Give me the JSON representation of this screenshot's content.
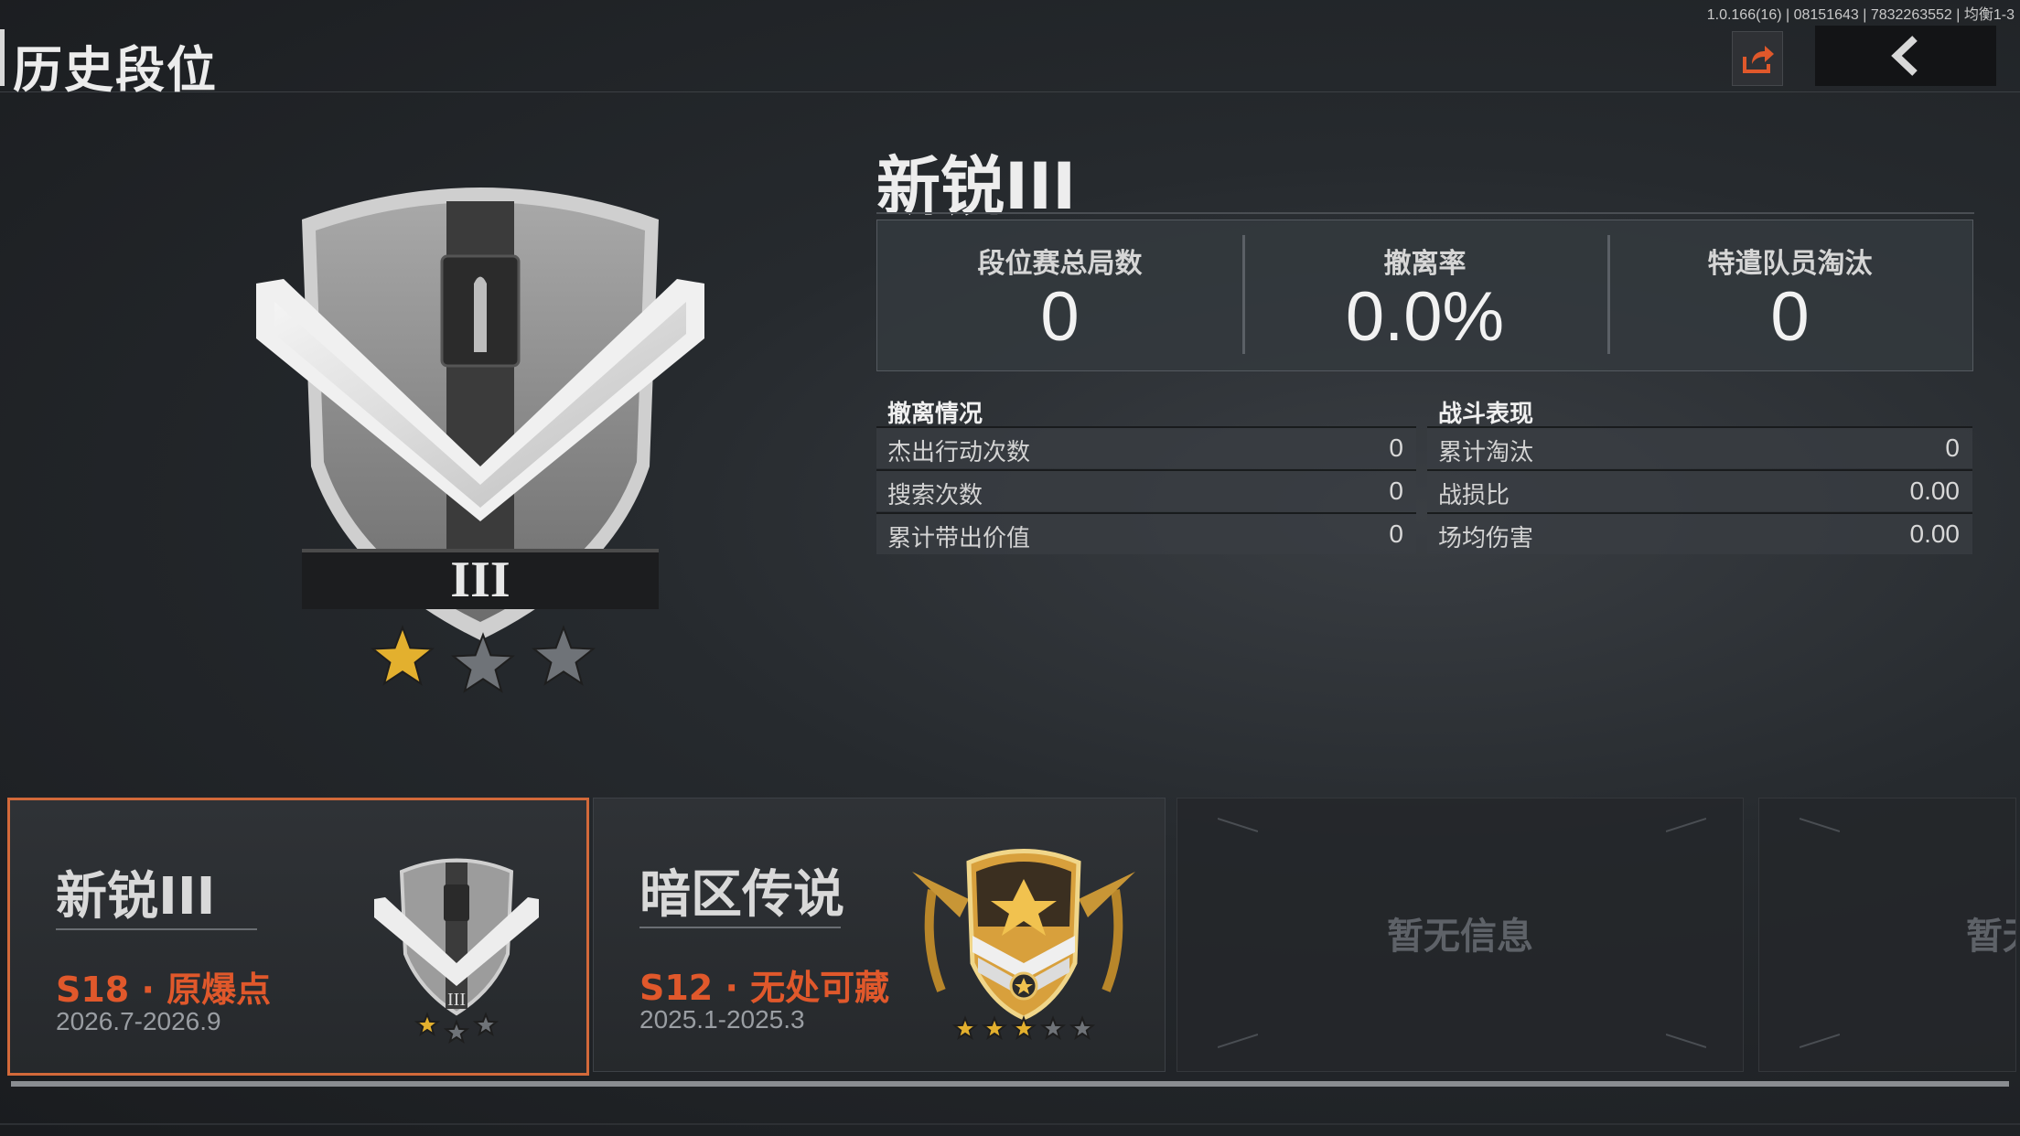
{
  "version_info": "1.0.166(16) | 08151643 | 7832263552 | 均衡1-3",
  "header": {
    "title": "历史段位"
  },
  "current_rank": {
    "name": "新锐III",
    "tier_numeral": "III",
    "stars_earned": 1,
    "stars_total": 3
  },
  "stats": [
    {
      "label": "段位赛总局数",
      "value": "0"
    },
    {
      "label": "撤离率",
      "value": "0.0%"
    },
    {
      "label": "特遣队员淘汰",
      "value": "0"
    }
  ],
  "evacuation": {
    "title": "撤离情况",
    "rows": [
      {
        "label": "杰出行动次数",
        "value": "0"
      },
      {
        "label": "搜索次数",
        "value": "0"
      },
      {
        "label": "累计带出价值",
        "value": "0"
      }
    ]
  },
  "combat": {
    "title": "战斗表现",
    "rows": [
      {
        "label": "累计淘汰",
        "value": "0"
      },
      {
        "label": "战损比",
        "value": "0.00"
      },
      {
        "label": "场均伤害",
        "value": "0.00"
      }
    ]
  },
  "seasons": [
    {
      "rank": "新锐III",
      "season": "S18 · 原爆点",
      "dates": "2026.7-2026.9",
      "emblem_numeral": "III",
      "stars_earned": 1,
      "stars_total": 3
    },
    {
      "rank": "暗区传说",
      "season": "S12 · 无处可藏",
      "dates": "2025.1-2025.3",
      "stars_earned": 3,
      "stars_total": 5
    },
    {
      "empty_text": "暂无信息"
    },
    {
      "empty_text": "暂无信息"
    }
  ],
  "colors": {
    "accent": "#e0582b",
    "star_gold": "#e3b02e",
    "star_gray": "#6f7378"
  },
  "icons": {
    "share": "share-icon",
    "back": "chevron-left-icon"
  }
}
